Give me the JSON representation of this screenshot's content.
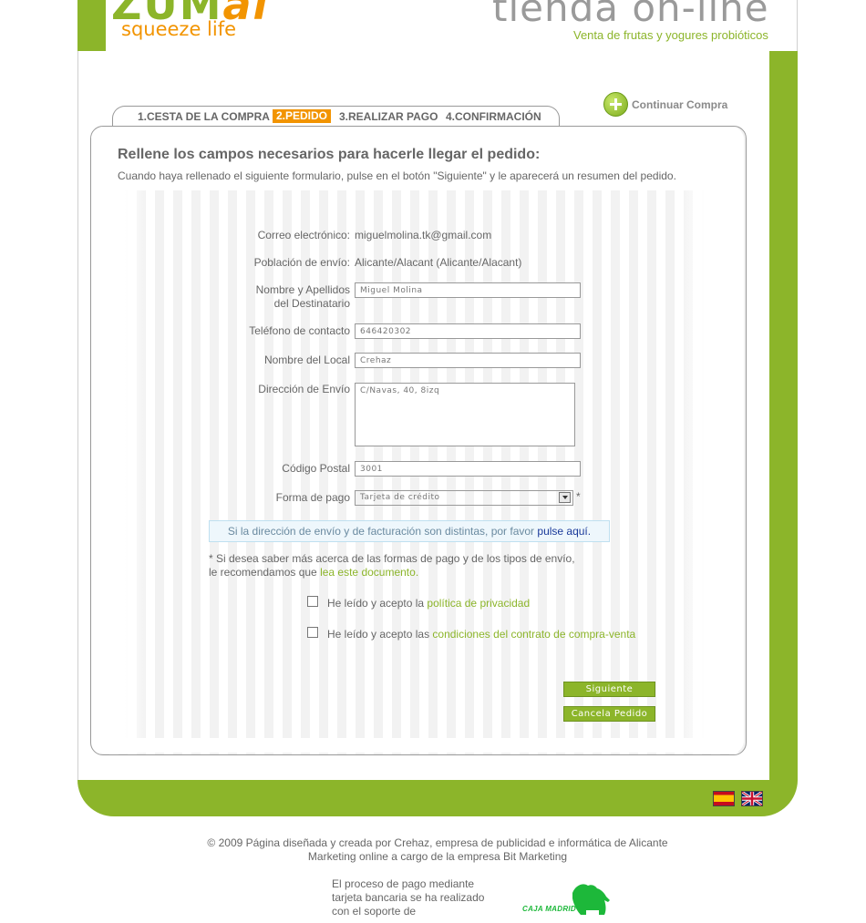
{
  "header": {
    "logo_text": "ZUM",
    "logo_suffix": "al",
    "slogan": "squeeze life",
    "store_title": "tienda on-line",
    "store_subtitle": "Venta de frutas y yogures probióticos",
    "brand_green": "#8cb52a",
    "brand_orange": "#f29400"
  },
  "continue": {
    "label": "Continuar Compra",
    "icon": "plus-circle-icon"
  },
  "tabs": [
    {
      "label": "1.CESTA DE LA COMPRA",
      "active": false
    },
    {
      "label": "2.PEDIDO",
      "active": true
    },
    {
      "label": "3.REALIZAR PAGO",
      "active": false
    },
    {
      "label": "4.CONFIRMACIÓN",
      "active": false
    }
  ],
  "form": {
    "heading": "Rellene los campos necesarios para hacerle llegar el pedido:",
    "subheading": "Cuando haya rellenado el siguiente formulario, pulse en el botón \"Siguiente\" y le aparecerá un resumen del pedido.",
    "email": {
      "label": "Correo electrónico:",
      "value": "miguelmolina.tk@gmail.com"
    },
    "town": {
      "label": "Población de envío:",
      "value": "Alicante/Alacant (Alicante/Alacant)"
    },
    "name": {
      "label_line1": "Nombre y Apellidos",
      "label_line2": "del Destinatario",
      "value": "Miguel Molina"
    },
    "phone": {
      "label": "Teléfono de contacto",
      "value": "646420302"
    },
    "local": {
      "label": "Nombre del Local",
      "value": "Crehaz"
    },
    "address": {
      "label": "Dirección de Envío",
      "value": "C/Navas, 40, 8izq"
    },
    "postal": {
      "label": "Código Postal",
      "value": "3001"
    },
    "payment": {
      "label": "Forma de pago",
      "value": "Tarjeta de crédito",
      "required_mark": "*"
    },
    "billing_text": "Si la dirección de envío y de facturación son distintas, por favor ",
    "billing_link": "pulse aquí.",
    "info_line1": "* Si desea saber más acerca de las formas de pago y de los tipos de envío,",
    "info_line2_prefix": "le recomendamos que ",
    "info_link": "lea este documento.",
    "privacy_prefix": "He leído y acepto la ",
    "privacy_link": "política de privacidad",
    "contract_prefix": "He leído y acepto las ",
    "contract_link": "condiciones del contrato de compra-venta",
    "next_button": "Siguiente",
    "cancel_button": "Cancela Pedido"
  },
  "footer": {
    "line1": "© 2009 Página diseñada y creada por Crehaz, empresa de publicidad e informática de Alicante",
    "line2": "Marketing online a cargo de la empresa Bit Marketing",
    "pay_note": "El proceso de pago mediante tarjeta bancaria se ha realizado con el soporte de",
    "bank_name": "CAJA MADRID"
  }
}
